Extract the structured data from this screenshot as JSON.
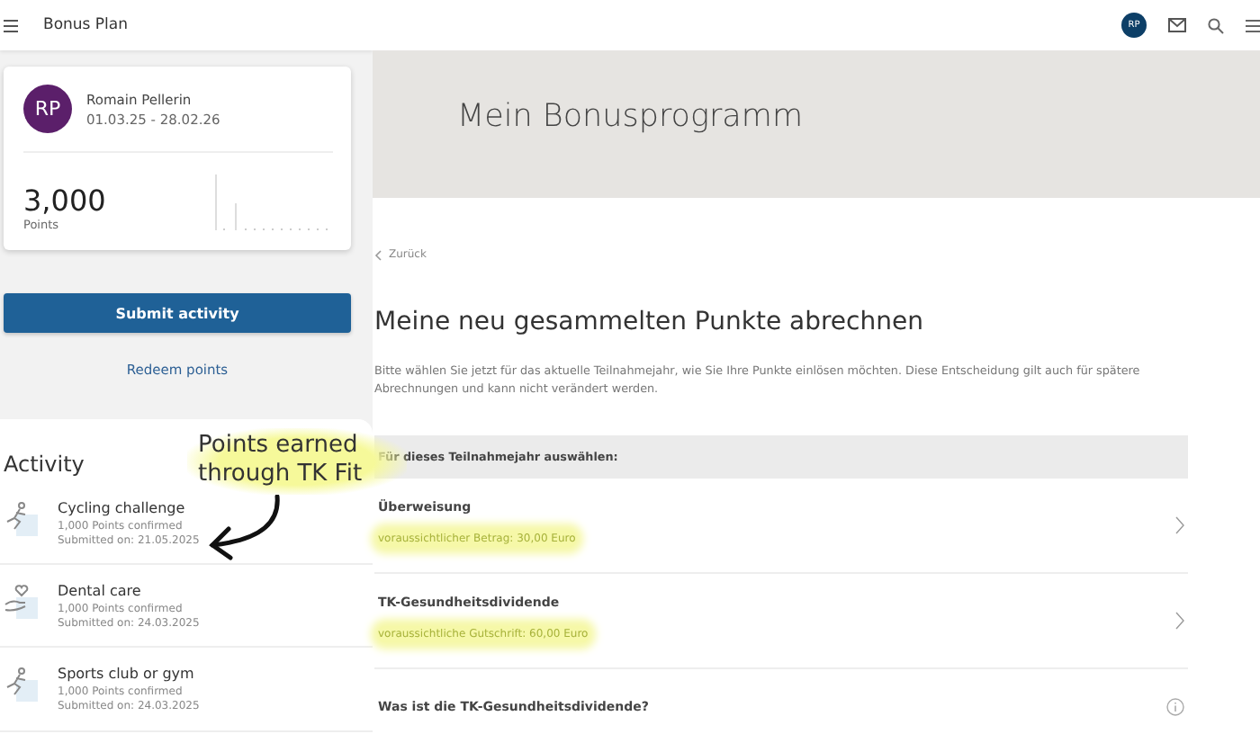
{
  "app_bar": {
    "title": "Bonus Plan",
    "avatar_initials": "RP"
  },
  "profile_card": {
    "initials": "RP",
    "name": "Romain Pellerin",
    "period": "01.03.25 - 28.02.26",
    "points": "3,000",
    "points_label": "Points"
  },
  "actions": {
    "primary": "Submit activity",
    "secondary": "Redeem points"
  },
  "activity": {
    "title": "Activity",
    "items": [
      {
        "kind": "sport",
        "title": "Cycling challenge",
        "status": "1,000 Points confirmed",
        "submitted": "Submitted on: 21.05.2025"
      },
      {
        "kind": "care",
        "title": "Dental care",
        "status": "1,000 Points confirmed",
        "submitted": "Submitted on: 24.03.2025"
      },
      {
        "kind": "sport",
        "title": "Sports club or gym",
        "status": "1,000 Points confirmed",
        "submitted": "Submitted on: 24.03.2025"
      }
    ]
  },
  "annotation": {
    "text": "Points earned through TK Fit"
  },
  "hero": {
    "title": "Mein Bonusprogramm"
  },
  "back_link": "Zurück",
  "heading": "Meine neu gesammelten Punkte abrechnen",
  "intro": "Bitte wählen Sie jetzt für das aktuelle Teilnahmejahr, wie Sie Ihre Punkte einlösen möchten. Diese Entscheidung gilt auch für spätere Abrechnungen und kann nicht verändert werden.",
  "options_header": "Für dieses Teilnahmejahr auswählen:",
  "options": [
    {
      "kind": "choice",
      "title": "Überweisung",
      "detail": "voraussichtlicher Betrag: 30,00 Euro",
      "highlighted": true
    },
    {
      "kind": "choice",
      "title": "TK-Gesundheitsdividende",
      "detail": "voraussichtliche Gutschrift: 60,00 Euro",
      "highlighted": true
    },
    {
      "kind": "info",
      "title": "Was ist die TK-Gesundheitsdividende?"
    }
  ]
}
